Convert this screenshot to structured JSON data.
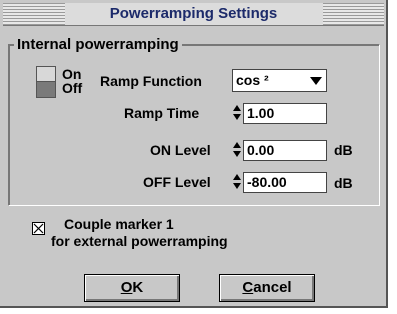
{
  "dialog": {
    "title": "Powerramping Settings"
  },
  "group": {
    "title": "Internal powerramping"
  },
  "toggle": {
    "on_label": "On",
    "off_label": "Off"
  },
  "ramp_function": {
    "label": "Ramp Function",
    "value": "cos ²"
  },
  "ramp_time": {
    "label": "Ramp Time",
    "value": "1.00"
  },
  "on_level": {
    "label": "ON Level",
    "value": "0.00",
    "unit": "dB"
  },
  "off_level": {
    "label": "OFF Level",
    "value": "-80.00",
    "unit": "dB"
  },
  "couple_marker": {
    "line1": "Couple marker 1",
    "line2": "for external powerramping",
    "checked": true
  },
  "buttons": {
    "ok_mnemonic": "O",
    "ok_rest": "K",
    "cancel_mnemonic": "C",
    "cancel_rest": "ancel"
  }
}
